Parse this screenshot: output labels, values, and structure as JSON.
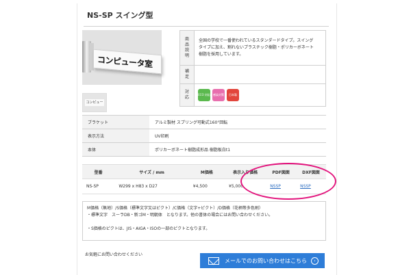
{
  "product": {
    "title": "NS-SP スイング型",
    "sign_text": "コンピュータ室",
    "thumb_text": "コンピュータ室"
  },
  "spec": {
    "rows": [
      {
        "label": "商品説明",
        "text_lines": [
          "全国の学校で一番使われているスタンダードタイプ。スイング",
          "タイプに加え、割れないプラスチック樹脂・ポリカーボネート",
          "樹脂を採用しています。"
        ]
      },
      {
        "label": "補足",
        "text_lines": []
      },
      {
        "label": "対応",
        "badges": [
          {
            "text": "ECO 対応",
            "color": "#5bb94e"
          },
          {
            "text": "感染対策",
            "color": "#e86fae"
          },
          {
            "text": "日本製",
            "color": "#e2453c"
          }
        ]
      }
    ]
  },
  "details": [
    {
      "key": "ブラケット",
      "value": "アルミ製材 スプリング可動式160°回転"
    },
    {
      "key": "表示方法",
      "value": "UV印刷"
    },
    {
      "key": "本体",
      "value": "ポリカーボネート樹脂成形品 樹脂板白t1"
    }
  ],
  "price_table": {
    "headers": [
      "型番",
      "サイズ / mm",
      "M価格",
      "表示入り価格",
      "PDF図面",
      "DXF図面"
    ],
    "rows": [
      {
        "model": "NS-SP",
        "size": "W299 x H83 x D27",
        "m_price": "¥4,500",
        "display_price": "¥5,000",
        "pdf": "NSSP",
        "dxf": "NSSP"
      }
    ],
    "highlight_color": "#e2137c"
  },
  "notes": [
    "M価格（無地）/S価格（標準文字又はピクト）/C価格（文字+ピクト）/D価格（花柄等多色刷）",
    "・標準文字　スーラDB・新ゴM・明朝体　となります。他の書体の場合にはお問い合わせください。",
    "",
    "・S価格のピクトは、JIS・AIGA・ISOの一部のピクトとなります。"
  ],
  "footer": {
    "inquiry_text": "お気軽にお問い合わせください",
    "mail_button": "メールでのお問い合わせはこちら",
    "button_color": "#2e7dd8"
  }
}
